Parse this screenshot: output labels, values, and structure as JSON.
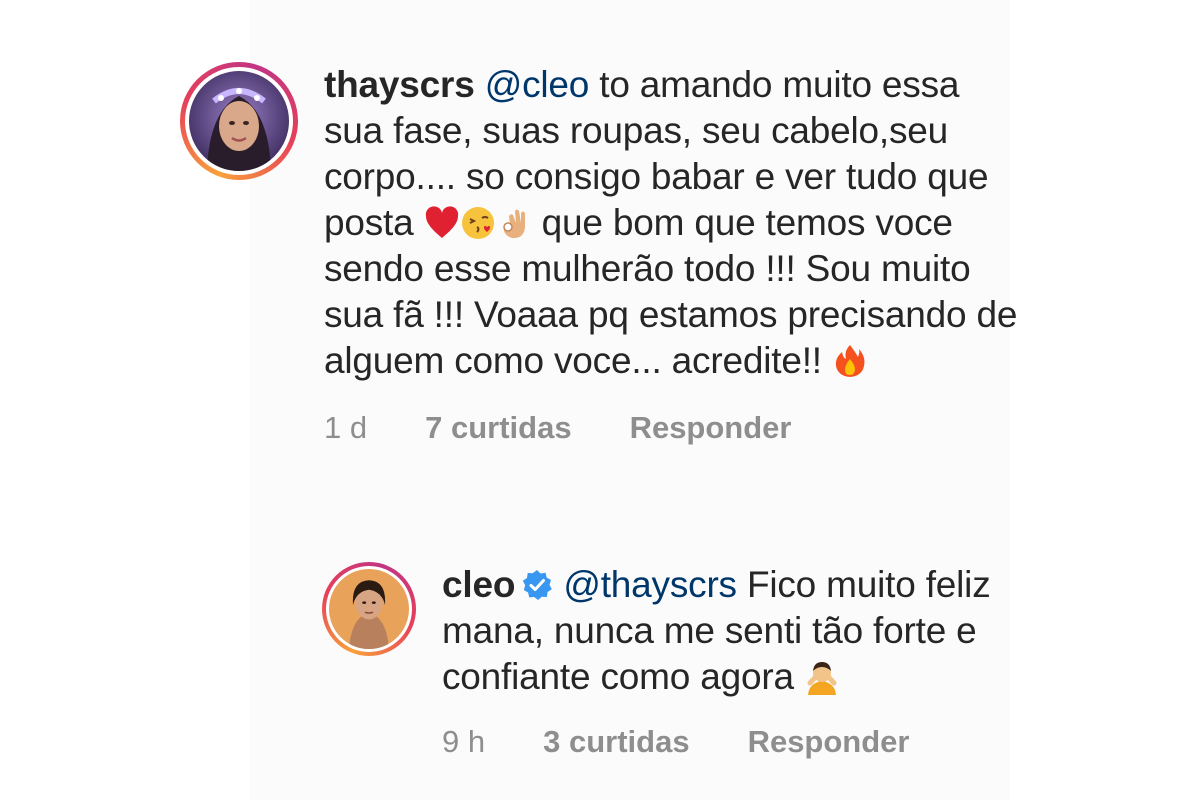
{
  "comments": [
    {
      "username": "thayscrs",
      "mention": "@cleo",
      "text_parts": [
        " to amando muito essa sua fase, suas roupas, seu cabelo,seu corpo.... so consigo babar e ver tudo que posta ",
        " que bom que temos voce sendo esse mulherão todo !!! Sou muito sua fã !!! Voaaa pq estamos precisando de alguem como voce... acredite!! "
      ],
      "emojis": [
        "heart-emoji",
        "kissing-face-emoji",
        "ok-hand-emoji",
        "fire-emoji"
      ],
      "time": "1 d",
      "likes": "7 curtidas",
      "reply_label": "Responder"
    },
    {
      "username": "cleo",
      "verified": true,
      "mention": "@thayscrs",
      "text_parts": [
        " Fico muito feliz mana, nunca me senti tão forte e confiante como agora "
      ],
      "emojis": [
        "person-gesturing-emoji"
      ],
      "time": "9 h",
      "likes": "3 curtidas",
      "reply_label": "Responder"
    }
  ],
  "colors": {
    "text": "#262626",
    "mention": "#00376b",
    "meta": "#8e8e8e",
    "verified": "#3897f0"
  }
}
